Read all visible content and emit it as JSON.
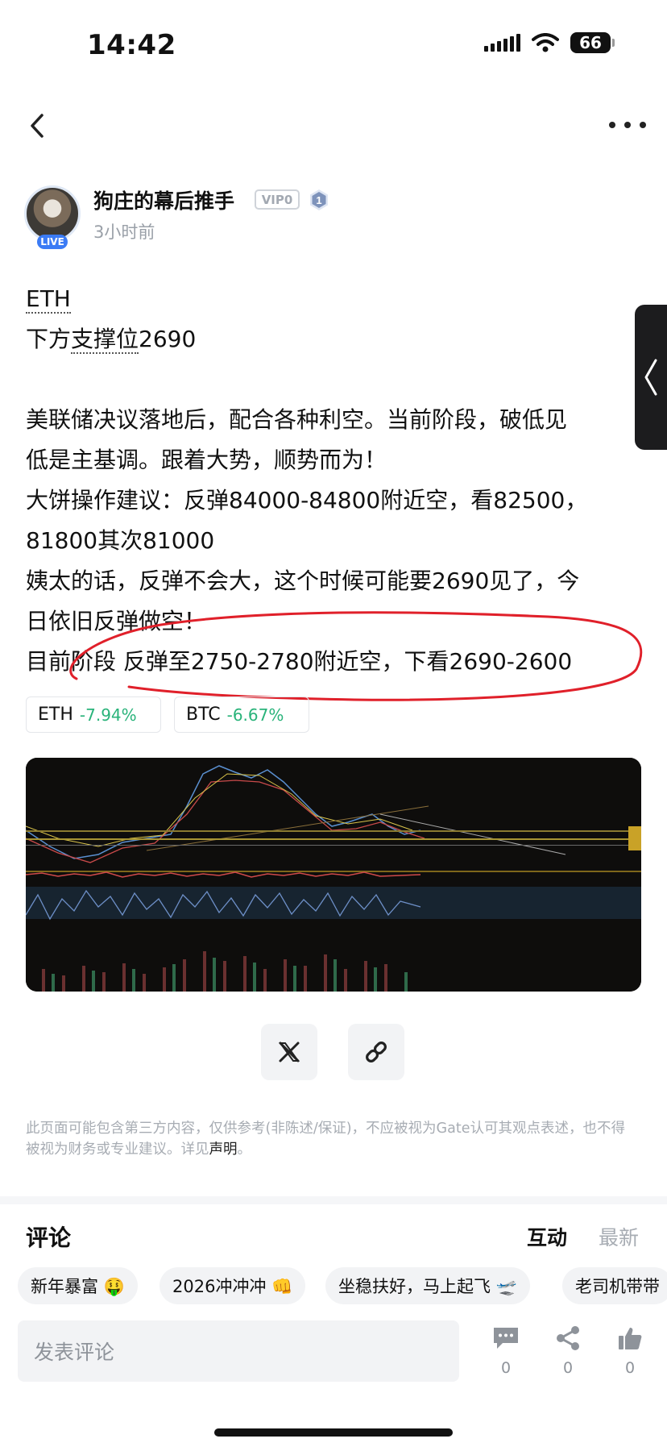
{
  "status_bar": {
    "time": "14:42",
    "battery": "66"
  },
  "author": {
    "name": "狗庄的幕后推手",
    "vip": "VIP0",
    "level": "1",
    "live": "LIVE",
    "time": "3小时前"
  },
  "post": {
    "line1": "ETH",
    "line2_prefix": "下方",
    "line2_dotted": "支撑位",
    "line2_suffix": "2690",
    "line3": "美联储决议落地后，配合各种利空。当前阶段，破低见",
    "line4": "低是主基调。跟着大势，顺势而为！",
    "line5": "大饼操作建议：反弹84000-84800附近空，看82500，",
    "line6": "81800其次81000",
    "line7": "姨太的话，反弹不会大，这个时候可能要2690见了，今",
    "line8": "日依旧反弹做空！",
    "line9": "目前阶段 反弹至2750-2780附近空，下看2690-2600"
  },
  "tokens": [
    {
      "symbol": "ETH",
      "change": "-7.94%"
    },
    {
      "symbol": "BTC",
      "change": "-6.67%"
    }
  ],
  "disclaimer": {
    "text": "此页面可能包含第三方内容，仅供参考(非陈述/保证)，不应被视为Gate认可其观点表述，也不得被视为财务或专业建议。详见",
    "link": "声明",
    "end": "。"
  },
  "comments": {
    "title": "评论",
    "tab_active": "互动",
    "tab_inactive": "最新",
    "chips": [
      "新年暴富 🤑",
      "2026冲冲冲 👊",
      "坐稳扶好，马上起飞 🛫",
      "老司机带带"
    ],
    "placeholder": "发表评论",
    "counts": {
      "comment": "0",
      "share": "0",
      "like": "0"
    }
  },
  "colors": {
    "accent_red": "#e0202a",
    "positive_green": "#29b37a",
    "live_blue": "#3b7bf5"
  }
}
